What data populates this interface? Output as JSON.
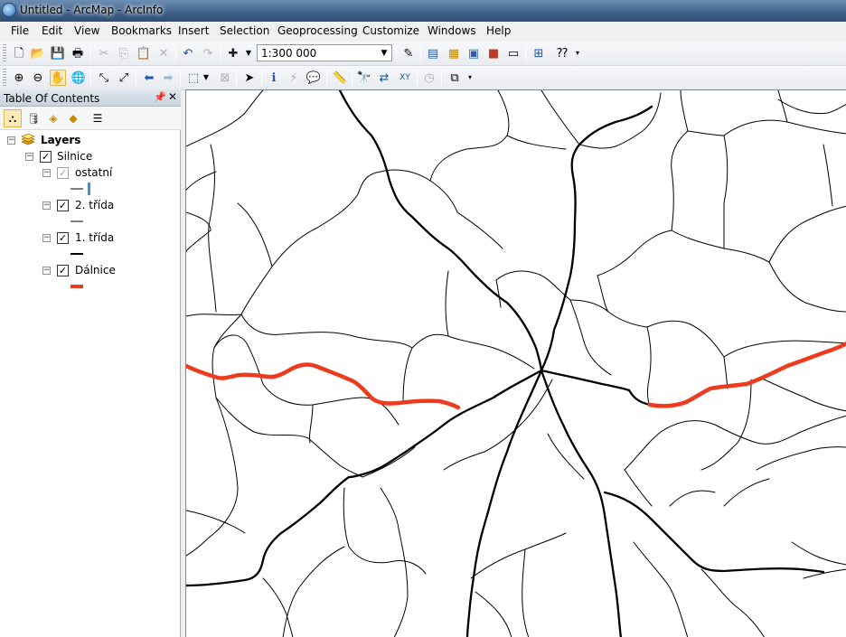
{
  "window": {
    "title": "Untitled - ArcMap - ArcInfo"
  },
  "menu": [
    "File",
    "Edit",
    "View",
    "Bookmarks",
    "Insert",
    "Selection",
    "Geoprocessing",
    "Customize",
    "Windows",
    "Help"
  ],
  "toolbar": {
    "scale": "1:300 000"
  },
  "toc": {
    "title": "Table Of Contents",
    "root": "Layers",
    "group": "Silnice",
    "sublayers": [
      {
        "label": "ostatní",
        "checked": true,
        "color": "#3b8fe0"
      },
      {
        "label": "2. třída",
        "checked": true,
        "color": "#000000"
      },
      {
        "label": "1. třída",
        "checked": true,
        "color": "#000000"
      },
      {
        "label": "Dálnice",
        "checked": true,
        "color": "#ee3a1e"
      }
    ]
  },
  "map": {
    "highway_color": "#ee3a1e",
    "road_color": "#000000"
  }
}
